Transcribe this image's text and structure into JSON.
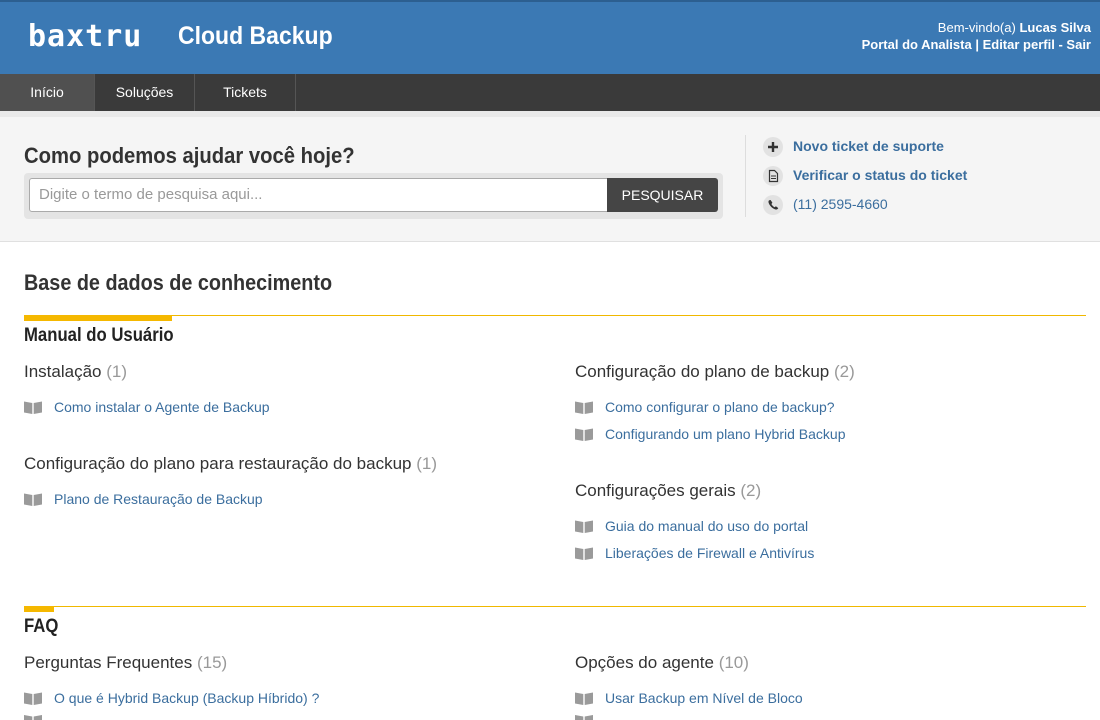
{
  "header": {
    "logo": "baxtru",
    "app_title": "Cloud Backup",
    "welcome_prefix": "Bem-vindo(a)",
    "user_name": "Lucas Silva",
    "portal_link": "Portal do Analista",
    "edit_profile_link": "Editar perfil",
    "logout_link": "Sair",
    "sep1": "|",
    "sep2": "-"
  },
  "nav": {
    "items": [
      {
        "label": "Início"
      },
      {
        "label": "Soluções"
      },
      {
        "label": "Tickets"
      }
    ]
  },
  "search": {
    "title": "Como podemos ajudar você hoje?",
    "placeholder": "Digite o termo de pesquisa aqui...",
    "button": "PESQUISAR"
  },
  "quick_links": {
    "new_ticket": "Novo ticket de suporte",
    "check_status": "Verificar o status do ticket",
    "phone": "(11) 2595-4660"
  },
  "kb": {
    "title": "Base de dados de conhecimento",
    "sections": [
      {
        "title": "Manual do Usuário",
        "categories": [
          {
            "title": "Instalação",
            "count": "(1)",
            "articles": [
              "Como instalar o Agente de Backup"
            ]
          },
          {
            "title": "Configuração do plano de backup",
            "count": "(2)",
            "articles": [
              "Como configurar o plano de backup?",
              "Configurando um plano Hybrid Backup"
            ]
          },
          {
            "title": "Configuração do plano para restauração do backup",
            "count": "(1)",
            "articles": [
              "Plano de Restauração de Backup"
            ]
          },
          {
            "title": "Configurações gerais",
            "count": "(2)",
            "articles": [
              "Guia do manual do uso do portal",
              "Liberações de Firewall e Antivírus"
            ]
          }
        ]
      },
      {
        "title": "FAQ",
        "categories": [
          {
            "title": "Perguntas Frequentes",
            "count": "(15)",
            "articles": [
              "O que é Hybrid Backup (Backup Híbrido) ?"
            ]
          },
          {
            "title": "Opções do agente",
            "count": "(10)",
            "articles": [
              "Usar Backup em Nível de Bloco"
            ]
          }
        ]
      }
    ]
  },
  "colors": {
    "header_bg": "#3b79b4",
    "nav_bg": "#3a3a3a",
    "accent": "#f5b800",
    "link": "#3b6e9e"
  }
}
